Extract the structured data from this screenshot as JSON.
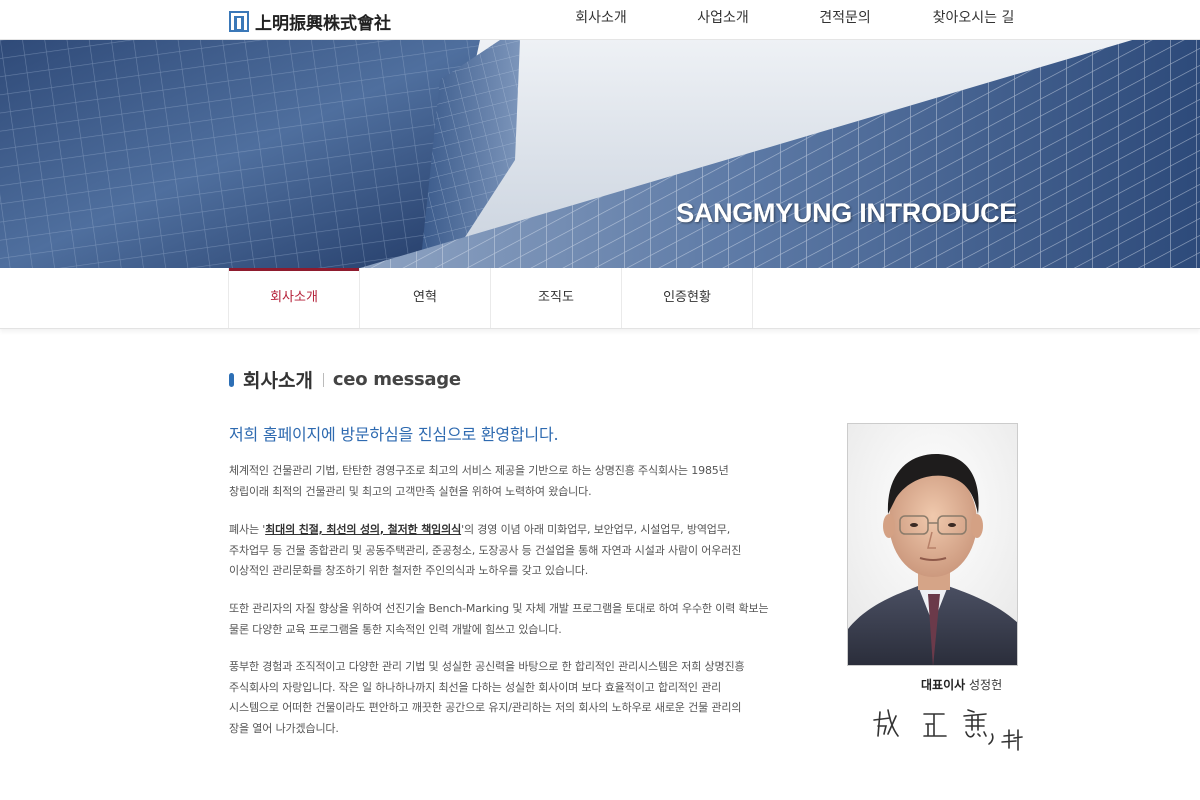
{
  "header": {
    "logo_text": "上明振興株式會社",
    "nav": [
      "회사소개",
      "사업소개",
      "견적문의",
      "찾아오시는 길"
    ]
  },
  "hero": {
    "title": "SANGMYUNG INTRODUCE"
  },
  "subnav": {
    "tabs": [
      "회사소개",
      "연혁",
      "조직도",
      "인증현황"
    ],
    "active_index": 0
  },
  "section": {
    "title": "회사소개",
    "subtitle": "ceo message"
  },
  "content": {
    "welcome": "저희 홈페이지에 방문하심을 진심으로 환영합니다.",
    "p1_l1": "체계적인 건물관리 기법, 탄탄한 경영구조로 최고의 서비스 제공을 기반으로 하는 상명진흥 주식회사는 1985년",
    "p1_l2": "창립이래 최적의 건물관리 및 최고의 고객만족 실현을 위하여 노력하여 왔습니다.",
    "p2_pre": "폐사는 '",
    "p2_highlight": "최대의 친절, 최선의 성의, 철저한 책임의식",
    "p2_post": "'의 경영 이념 아래 미화업무, 보안업무, 시설업무, 방역업무,",
    "p2_l2": "주차업무 등 건물 종합관리 및 공동주택관리, 준공청소, 도장공사 등 건설업을 통해 자연과 시설과 사람이 어우러진",
    "p2_l3": "이상적인 관리문화를 창조하기 위한 철저한 주인의식과 노하우를 갖고 있습니다.",
    "p3_l1": "또한 관리자의 자질 향상을 위하여 선진기술 Bench-Marking 및 자체 개발 프로그램을 토대로 하여 우수한 이력 확보는",
    "p3_l2": "물론 다양한 교육 프로그램을 통한 지속적인 인력 개발에 힘쓰고 있습니다.",
    "p4_l1": "풍부한 경험과 조직적이고 다양한 관리 기법 및 성실한 공신력을 바탕으로 한 합리적인 관리시스템은 저희 상명진흥",
    "p4_l2": "주식회사의 자랑입니다. 작은 일 하나하나까지 최선을 다하는 성실한 회사이며 보다 효율적이고 합리적인 관리",
    "p4_l3": "시스템으로 어떠한 건물이라도 편안하고 깨끗한 공간으로 유지/관리하는 저의 회사의 노하우로 새로운 건물 관리의",
    "p4_l4": "장을 열어 나가겠습니다."
  },
  "ceo": {
    "role": "대표이사",
    "name": "성정헌",
    "signature_text": "成 正 憲, 拜"
  },
  "colors": {
    "accent_blue": "#2e6ab0",
    "active_tab": "#b5223a",
    "active_bar": "#8e1b2e"
  }
}
